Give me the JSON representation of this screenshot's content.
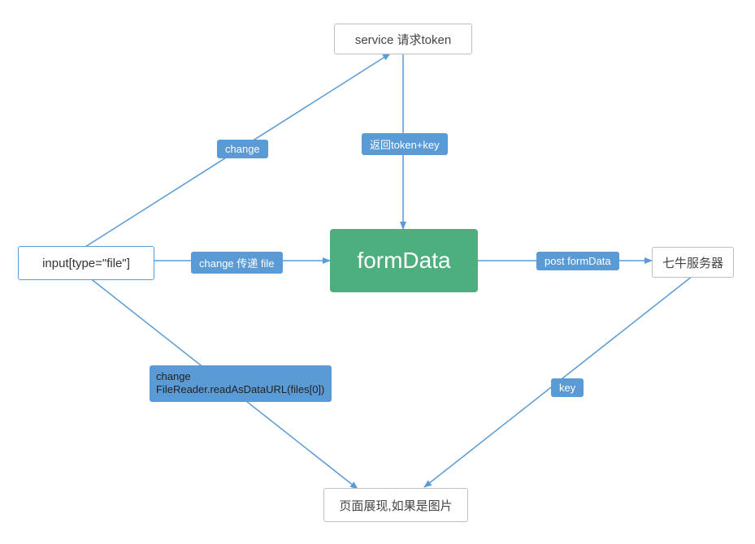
{
  "nodes": {
    "service": {
      "label": "service 请求token"
    },
    "input": {
      "label": "input[type=\"file\"]"
    },
    "formData": {
      "label": "formData"
    },
    "qiniu": {
      "label": "七牛服务器"
    },
    "display": {
      "label": "页面展现,如果是图片"
    }
  },
  "edges": {
    "change": "change",
    "returnTokenKey": "返回token+key",
    "changePassFile": "change 传递 file",
    "postFormData": "post formData",
    "fileReader": "change FileReader.readAsDataURL(files[0])",
    "key": "key"
  },
  "chart_data": {
    "type": "diagram",
    "title": "",
    "nodes": [
      {
        "id": "input",
        "label": "input[type=\"file\"]",
        "shape": "box"
      },
      {
        "id": "service",
        "label": "service 请求token",
        "shape": "box"
      },
      {
        "id": "formData",
        "label": "formData",
        "shape": "box-emphasis"
      },
      {
        "id": "qiniu",
        "label": "七牛服务器",
        "shape": "box"
      },
      {
        "id": "display",
        "label": "页面展现,如果是图片",
        "shape": "box"
      }
    ],
    "edges": [
      {
        "from": "input",
        "to": "service",
        "label": "change"
      },
      {
        "from": "service",
        "to": "formData",
        "label": "返回token+key"
      },
      {
        "from": "input",
        "to": "formData",
        "label": "change 传递 file"
      },
      {
        "from": "formData",
        "to": "qiniu",
        "label": "post formData"
      },
      {
        "from": "input",
        "to": "display",
        "label": "change FileReader.readAsDataURL(files[0])"
      },
      {
        "from": "qiniu",
        "to": "display",
        "label": "key"
      }
    ]
  }
}
